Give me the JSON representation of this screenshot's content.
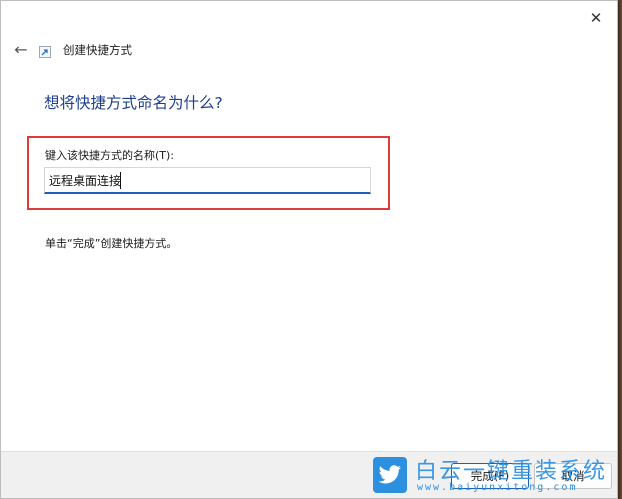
{
  "window": {
    "title": "创建快捷方式"
  },
  "main": {
    "heading": "想将快捷方式命名为什么?",
    "field_label": "键入该快捷方式的名称(T):",
    "name_value": "远程桌面连接",
    "hint": "单击“完成”创建快捷方式。"
  },
  "footer": {
    "finish_label": "完成(F)",
    "cancel_label": "取消"
  },
  "watermark": {
    "brand": "白云一键重装系统",
    "url": "www.baiyunxitong.com"
  },
  "icons": {
    "back": "back-arrow-icon",
    "close": "close-icon",
    "wizard": "shortcut-icon",
    "brand": "twitter-bird-icon"
  },
  "colors": {
    "heading": "#1f3f8f",
    "highlight": "#e03a3a",
    "accent": "#1f5fbf",
    "watermark": "#2d8fe0"
  }
}
